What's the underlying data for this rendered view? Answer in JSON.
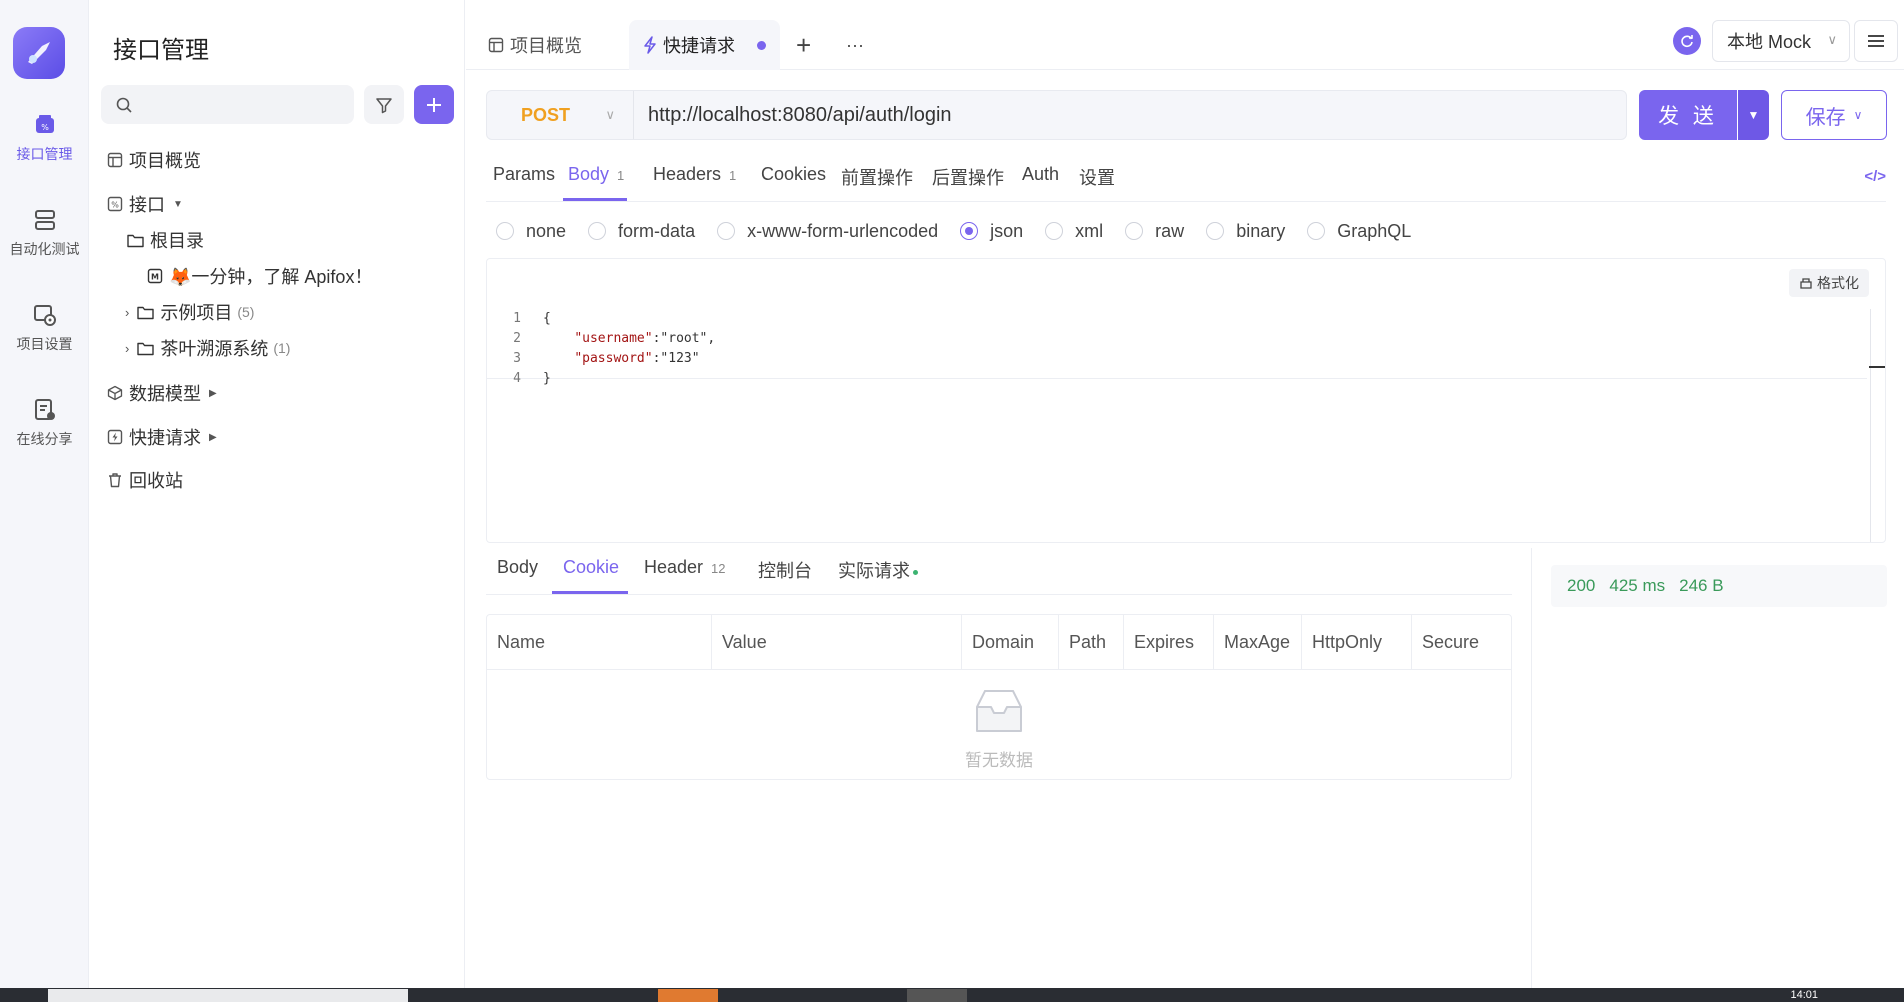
{
  "rail": {
    "items": [
      {
        "label": "接口管理",
        "icon": "api-grid-icon"
      },
      {
        "label": "自动化测试",
        "icon": "stack-icon"
      },
      {
        "label": "项目设置",
        "icon": "settings-icon"
      },
      {
        "label": "在线分享",
        "icon": "share-doc-icon"
      }
    ]
  },
  "tree": {
    "title": "接口管理",
    "search_placeholder": "",
    "nodes": {
      "overview": "项目概览",
      "api": "接口",
      "root": "根目录",
      "intro_doc": "🦊一分钟，了解 Apifox！",
      "examples": "示例项目",
      "examples_count": "(5)",
      "tea": "茶叶溯源系统",
      "tea_count": "(1)",
      "models": "数据模型",
      "quick": "快捷请求",
      "trash": "回收站"
    }
  },
  "topbar": {
    "tab_overview": "项目概览",
    "tab_quick": "快捷请求",
    "add": "+",
    "more": "···",
    "env": "本地 Mock"
  },
  "request": {
    "method": "POST",
    "url": "http://localhost:8080/api/auth/login",
    "send_label": "发 送",
    "save_label": "保存",
    "tabs": {
      "params": "Params",
      "body": "Body",
      "body_badge": "1",
      "headers": "Headers",
      "headers_badge": "1",
      "cookies": "Cookies",
      "pre": "前置操作",
      "post": "后置操作",
      "auth": "Auth",
      "settings": "设置"
    },
    "body_types": [
      "none",
      "form-data",
      "x-www-form-urlencoded",
      "json",
      "xml",
      "raw",
      "binary",
      "GraphQL"
    ],
    "selected_body_type": "json",
    "format_label": "格式化",
    "code_lines": {
      "n1": "1",
      "n2": "2",
      "n3": "3",
      "n4": "4",
      "l1": "{",
      "l2_key": "\"username\"",
      "l2_val": ":\"root\",",
      "l3_key": "\"password\"",
      "l3_val": ":\"123\"",
      "l4": "}"
    }
  },
  "response": {
    "tabs": {
      "body": "Body",
      "cookie": "Cookie",
      "header": "Header",
      "header_badge": "12",
      "console": "控制台",
      "actual": "实际请求"
    },
    "status": "200",
    "time": "425 ms",
    "size": "246 B",
    "columns": [
      "Name",
      "Value",
      "Domain",
      "Path",
      "Expires",
      "MaxAge",
      "HttpOnly",
      "Secure"
    ],
    "empty_text": "暂无数据"
  },
  "taskbar": {
    "clock": "14:01"
  },
  "colors": {
    "accent": "#7a65ee",
    "method_post": "#f0a020",
    "status_ok": "#3a9a5a"
  }
}
